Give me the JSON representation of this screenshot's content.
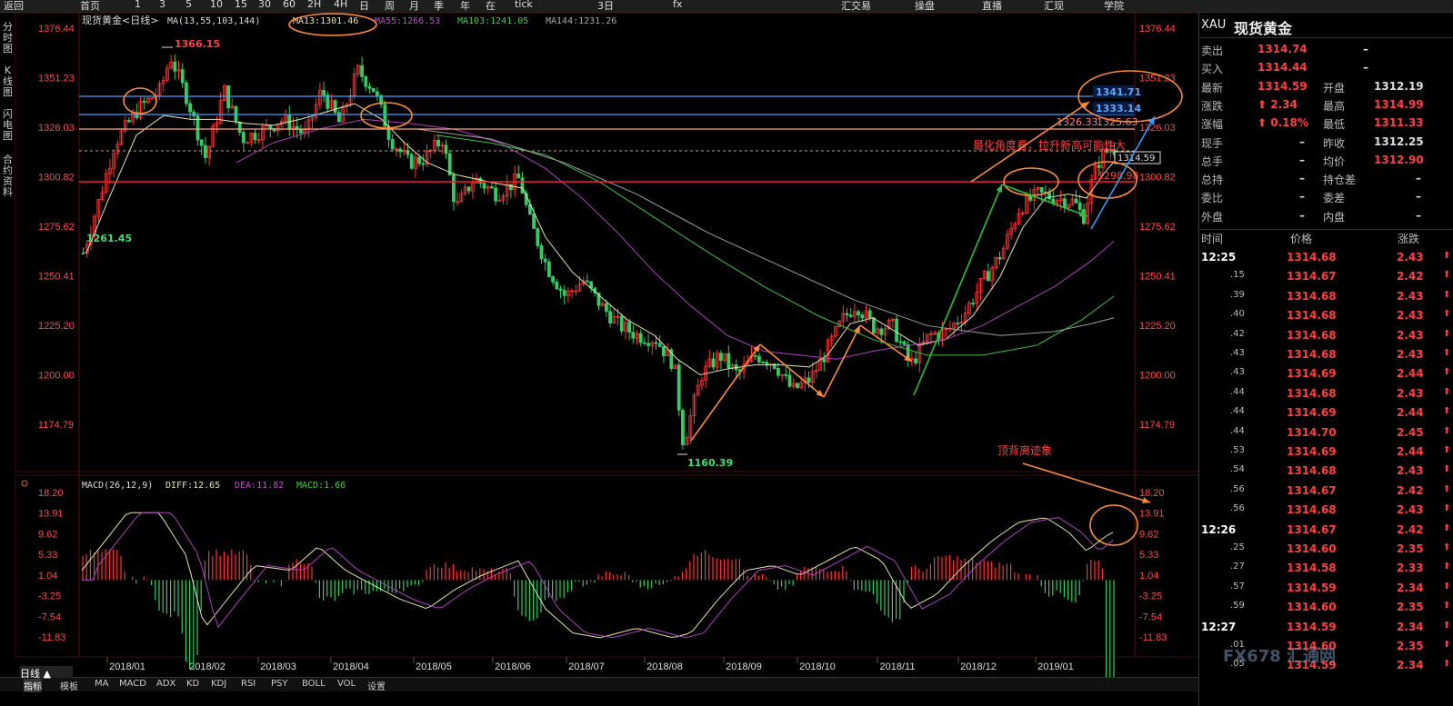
{
  "toolbar": {
    "back": "返回",
    "home": "首页",
    "periods": [
      "1",
      "3",
      "5",
      "10",
      "15",
      "30",
      "60",
      "2H",
      "4H",
      "日",
      "周",
      "月",
      "季",
      "年",
      "在",
      "tick",
      "3日"
    ],
    "fx": "fx",
    "trade": "汇交易",
    "chart": "操盘",
    "live": "直播",
    "forex": "汇现",
    "school": "学院"
  },
  "leftnav": [
    "分时图",
    "K线图",
    "闪电图",
    "合约资料"
  ],
  "header": {
    "title": "现货黄金<日线>",
    "ma_label": "MA(13,55,103,144)",
    "ma13": "MA13:1301.46",
    "ma55": "MA55:1266.53",
    "ma103": "MA103:1241.05",
    "ma144": "MA144:1231.26"
  },
  "macd_header": {
    "label": "MACD(26,12,9)",
    "diff": "DIFF:12.65",
    "dea": "DEA:11.82",
    "macd": "MACD:1.66"
  },
  "price_axis": [
    "1376.44",
    "1351.23",
    "1326.03",
    "1300.82",
    "1275.62",
    "1250.41",
    "1225.20",
    "1200.00",
    "1174.79"
  ],
  "macd_axis": [
    "18.20",
    "13.91",
    "9.62",
    "5.33",
    "1.04",
    "-3.25",
    "-7.54",
    "-11.83"
  ],
  "months": [
    "2018/01",
    "2018/02",
    "2018/03",
    "2018/04",
    "2018/05",
    "2018/06",
    "2018/07",
    "2018/08",
    "2018/09",
    "2018/10",
    "2018/11",
    "2018/12",
    "2019/01"
  ],
  "annotations": {
    "high": "1366.15",
    "low_start": "1261.45",
    "low": "1160.39",
    "l1": "1341.71",
    "l2": "1333.14",
    "l3": "1326.33",
    "l4": "1325.63",
    "l5": "1298.98",
    "last": "1314.59",
    "note1": "最化角度看，拉升新高可能性大",
    "note2": "顶背离迹象"
  },
  "colors": {
    "up": "#ff3333",
    "down": "#33cc66",
    "ma13": "#e6e6aa",
    "ma55": "#b040c0",
    "ma103": "#40c040",
    "ma144": "#9aa0a0"
  },
  "bottom": {
    "period": "日线 ▲",
    "tabs": [
      "指标",
      "模板",
      "MA",
      "MACD",
      "ADX",
      "KD",
      "KDJ",
      "RSI",
      "PSY",
      "BOLL",
      "VOL",
      "设置"
    ]
  },
  "quote": {
    "code": "XAU",
    "name": "现货黄金",
    "rows": [
      {
        "l1": "卖出",
        "v1": "1314.74",
        "l2": "",
        "v2": "–"
      },
      {
        "l1": "买入",
        "v1": "1314.44",
        "l2": "",
        "v2": "–"
      },
      {
        "l1": "最新",
        "v1": "1314.59",
        "l2": "开盘",
        "v2": "1312.19"
      },
      {
        "l1": "涨跌",
        "v1": "⬆ 2.34",
        "l2": "最高",
        "v2": "1314.99"
      },
      {
        "l1": "涨幅",
        "v1": "⬆ 0.18%",
        "l2": "最低",
        "v2": "1311.33"
      },
      {
        "l1": "现手",
        "v1": "–",
        "l2": "昨收",
        "v2": "1312.25"
      },
      {
        "l1": "总手",
        "v1": "–",
        "l2": "均价",
        "v2": "1312.90"
      },
      {
        "l1": "总持",
        "v1": "–",
        "l2": "持仓差",
        "v2": "–"
      },
      {
        "l1": "委比",
        "v1": "–",
        "l2": "委差",
        "v2": "–"
      },
      {
        "l1": "外盘",
        "v1": "–",
        "l2": "内盘",
        "v2": "–"
      }
    ],
    "tick_headers": [
      "时间",
      "价格",
      "涨跌"
    ],
    "ticks": [
      {
        "t": "12:25",
        "p": "1314.68",
        "c": "2.43"
      },
      {
        "t": ".15",
        "p": "1314.67",
        "c": "2.42"
      },
      {
        "t": ".39",
        "p": "1314.68",
        "c": "2.43"
      },
      {
        "t": ".40",
        "p": "1314.68",
        "c": "2.43"
      },
      {
        "t": ".42",
        "p": "1314.68",
        "c": "2.43"
      },
      {
        "t": ".43",
        "p": "1314.68",
        "c": "2.43"
      },
      {
        "t": ".43",
        "p": "1314.69",
        "c": "2.44"
      },
      {
        "t": ".44",
        "p": "1314.68",
        "c": "2.43"
      },
      {
        "t": ".44",
        "p": "1314.69",
        "c": "2.44"
      },
      {
        "t": ".44",
        "p": "1314.70",
        "c": "2.45"
      },
      {
        "t": ".53",
        "p": "1314.69",
        "c": "2.44"
      },
      {
        "t": ".54",
        "p": "1314.68",
        "c": "2.43"
      },
      {
        "t": ".56",
        "p": "1314.67",
        "c": "2.42"
      },
      {
        "t": ".56",
        "p": "1314.68",
        "c": "2.43"
      },
      {
        "t": "12:26",
        "p": "1314.67",
        "c": "2.42"
      },
      {
        "t": ".25",
        "p": "1314.60",
        "c": "2.35"
      },
      {
        "t": ".27",
        "p": "1314.58",
        "c": "2.33"
      },
      {
        "t": ".57",
        "p": "1314.59",
        "c": "2.34"
      },
      {
        "t": ".59",
        "p": "1314.60",
        "c": "2.35"
      },
      {
        "t": "12:27",
        "p": "1314.59",
        "c": "2.34"
      },
      {
        "t": ".01",
        "p": "1314.60",
        "c": "2.35"
      },
      {
        "t": ".05",
        "p": "1314.59",
        "c": "2.34"
      }
    ]
  },
  "watermark": "FX678 汇通网"
}
